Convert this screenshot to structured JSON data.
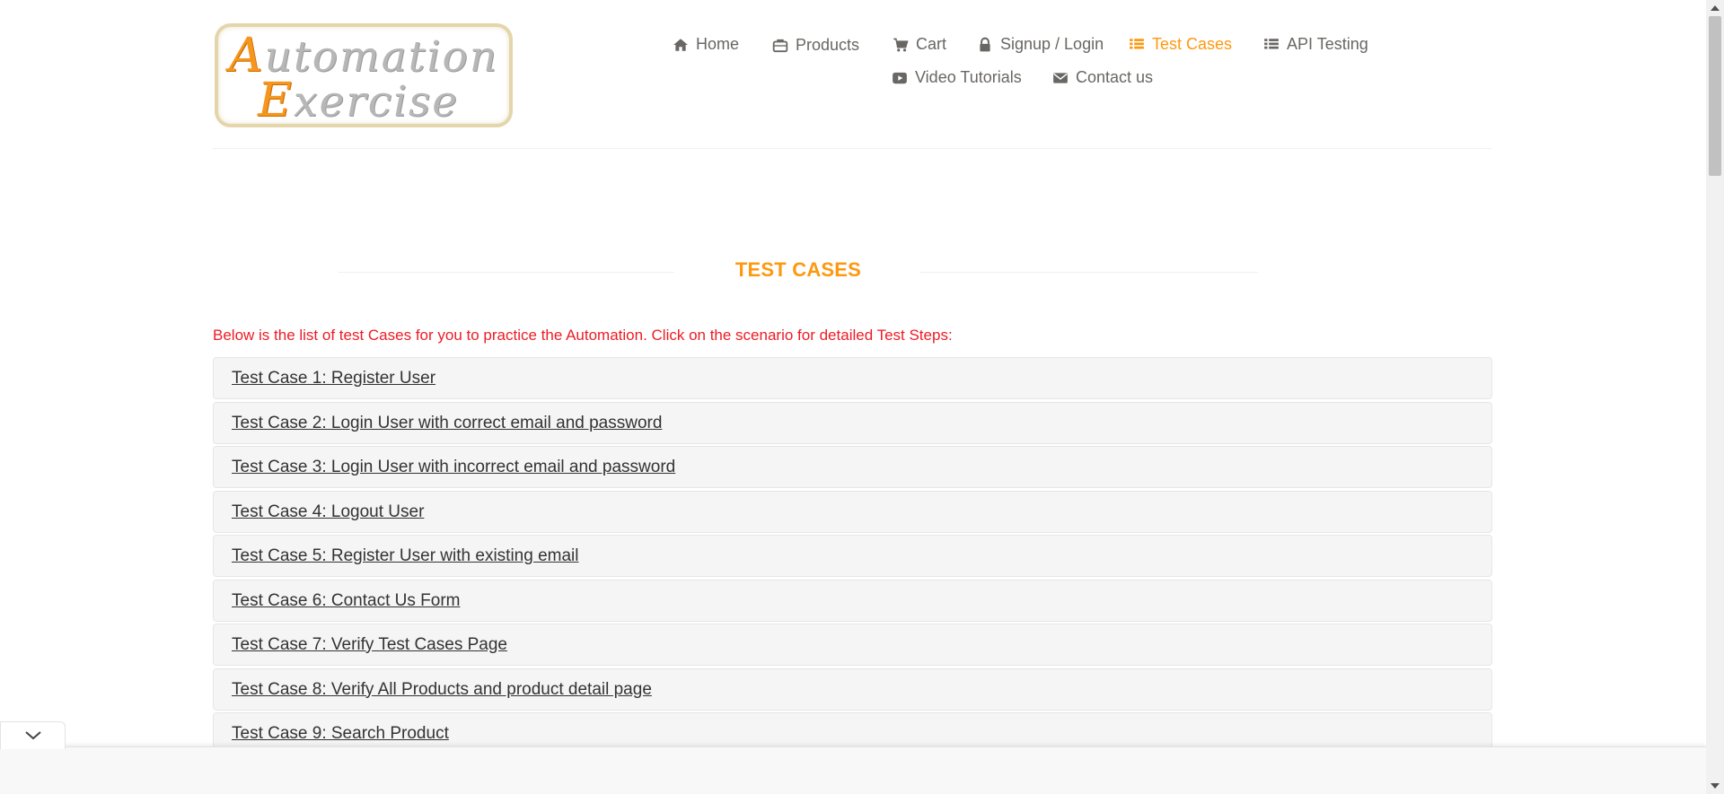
{
  "logo": {
    "line1_cap": "A",
    "line1_rest": "utomation",
    "line2_cap": "E",
    "line2_rest": "xercise"
  },
  "nav": {
    "row1": [
      {
        "label": "Home",
        "icon": "home-icon",
        "active": false
      },
      {
        "label": "Products",
        "icon": "briefcase-icon",
        "active": false
      },
      {
        "label": "Cart",
        "icon": "cart-icon",
        "active": false
      },
      {
        "label": "Signup / Login",
        "icon": "lock-icon",
        "active": false
      },
      {
        "label": "Test Cases",
        "icon": "list-icon",
        "active": true
      },
      {
        "label": "API Testing",
        "icon": "list-icon",
        "active": false
      }
    ],
    "row2": [
      {
        "label": "Video Tutorials",
        "icon": "youtube-icon",
        "active": false
      },
      {
        "label": "Contact us",
        "icon": "envelope-icon",
        "active": false
      }
    ]
  },
  "main": {
    "title": "TEST CASES",
    "intro": "Below is the list of test Cases for you to practice the Automation. Click on the scenario for detailed Test Steps:",
    "cases": [
      "Test Case 1: Register User",
      "Test Case 2: Login User with correct email and password",
      "Test Case 3: Login User with incorrect email and password",
      "Test Case 4: Logout User",
      "Test Case 5: Register User with existing email",
      "Test Case 6: Contact Us Form",
      "Test Case 7: Verify Test Cases Page",
      "Test Case 8: Verify All Products and product detail page",
      "Test Case 9: Search Product"
    ]
  },
  "colors": {
    "accent": "#fe980f",
    "intro_red": "#ee1c25",
    "nav_text": "#696763",
    "case_bg": "#f5f5f5"
  }
}
